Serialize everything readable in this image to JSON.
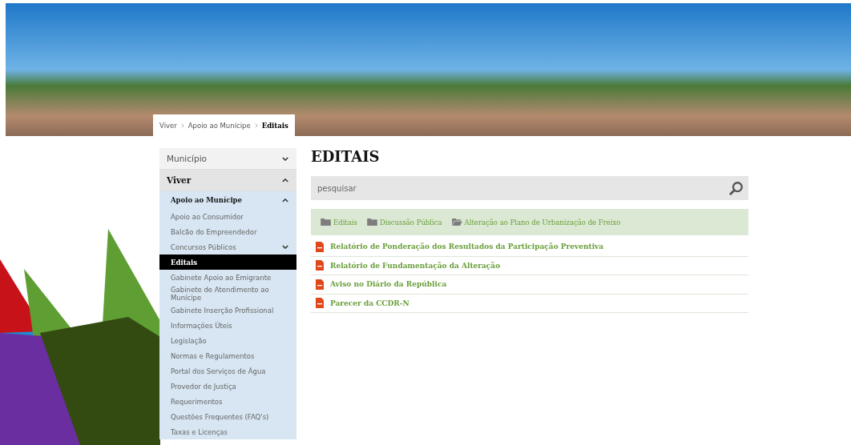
{
  "breadcrumb": [
    {
      "label": "Viver",
      "current": false
    },
    {
      "label": "Apoio ao Munícipe",
      "current": false
    },
    {
      "label": "Editais",
      "current": true
    }
  ],
  "menu": [
    {
      "label": "Município",
      "kind": "folder",
      "expanded": false,
      "selected": false
    },
    {
      "label": "Viver",
      "kind": "folder",
      "expanded": true,
      "selected": true,
      "children": [
        {
          "label": "Apoio ao Munícipe",
          "kind": "folder",
          "expanded": true,
          "selected": true,
          "children": [
            {
              "label": "Apoio ao Consumidor",
              "kind": "link",
              "selected": false
            },
            {
              "label": "Balcão do Empreendedor",
              "kind": "link",
              "selected": false
            },
            {
              "label": "Concursos Públicos",
              "kind": "folder",
              "expanded": false,
              "selected": false
            },
            {
              "label": "Editais",
              "kind": "link",
              "selected": true
            },
            {
              "label": "Gabinete Apoio ao Emigrante",
              "kind": "link",
              "selected": false
            },
            {
              "label": "Gabinete de Atendimento ao Munícipe",
              "kind": "link",
              "selected": false
            },
            {
              "label": "Gabinete Inserção Profissional",
              "kind": "link",
              "selected": false
            },
            {
              "label": "Informações Úteis",
              "kind": "link",
              "selected": false
            },
            {
              "label": "Legislação",
              "kind": "link",
              "selected": false
            },
            {
              "label": "Normas e Regulamentos",
              "kind": "link",
              "selected": false
            },
            {
              "label": "Portal dos Serviços de Água",
              "kind": "link",
              "selected": false
            },
            {
              "label": "Provedor de Justiça",
              "kind": "link",
              "selected": false
            },
            {
              "label": "Requerimentos",
              "kind": "link",
              "selected": false
            },
            {
              "label": "Questões Frequentes (FAQ's)",
              "kind": "link",
              "selected": false
            },
            {
              "label": "Taxas e Licenças",
              "kind": "link",
              "selected": false
            }
          ]
        }
      ]
    }
  ],
  "page_title": "EDITAIS",
  "search": {
    "placeholder": "pesquisar"
  },
  "folder_path": [
    {
      "label": "Editais",
      "open": false
    },
    {
      "label": "Discussão Pública",
      "open": false
    },
    {
      "label": "Alteração ao Plano de Urbanização de Freixo",
      "open": true
    }
  ],
  "documents": [
    "Relatório de Ponderação dos Resultados da Participação Preventiva",
    "Relatório de Fundamentação da Alteração",
    "Aviso no Diário da República",
    "Parecer da CCDR-N"
  ]
}
